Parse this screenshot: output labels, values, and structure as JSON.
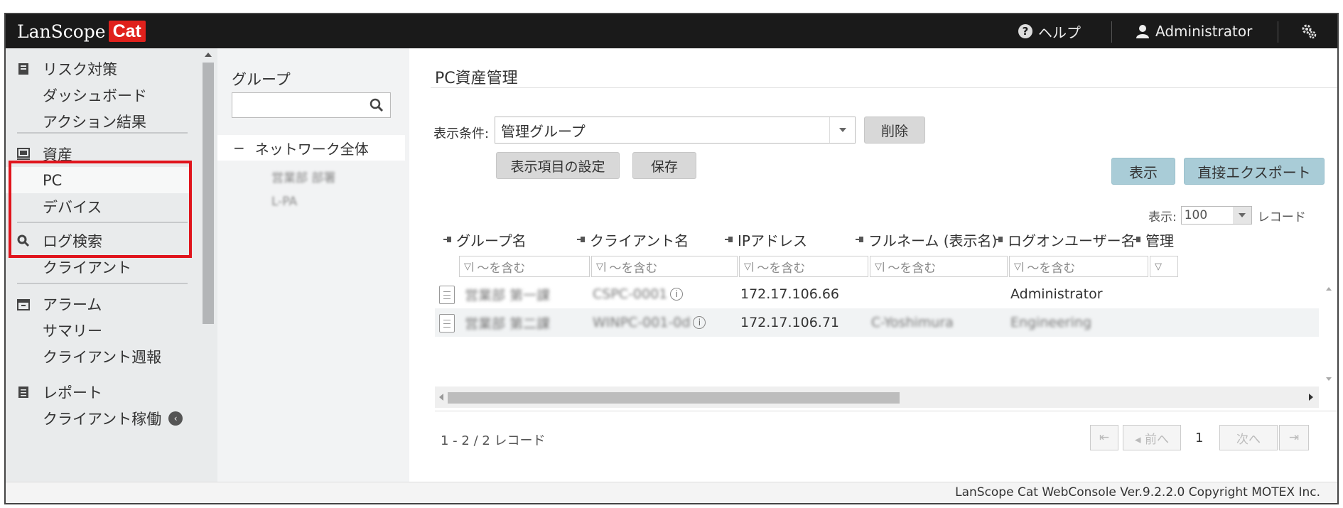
{
  "app": {
    "logo_text": "LanScope",
    "logo_badge": "Cat",
    "brand_color": "#e0211c",
    "help_label": "ヘルプ",
    "user_label": "Administrator"
  },
  "nav": {
    "risk": {
      "label": "リスク対策",
      "items": [
        "ダッシュボード",
        "アクション結果"
      ]
    },
    "asset": {
      "label": "資産",
      "items": [
        "PC",
        "デバイス"
      ]
    },
    "log": {
      "label": "ログ検索",
      "items": [
        "クライアント"
      ]
    },
    "alarm": {
      "label": "アラーム",
      "items": [
        "サマリー",
        "クライアント週報"
      ]
    },
    "report": {
      "label": "レポート",
      "items": [
        "クライアント稼働"
      ]
    },
    "highlight_color": "#e0141c"
  },
  "group_panel": {
    "title": "グループ",
    "search_placeholder": "",
    "tree_root": "ネットワーク全体",
    "tree_children": [
      "営業部 部署",
      "L-PA"
    ]
  },
  "main": {
    "title": "PC資産管理",
    "condition_label": "表示条件:",
    "condition_value": "管理グループ",
    "delete_button": "削除",
    "column_settings_button": "表示項目の設定",
    "save_button": "保存",
    "show_button": "表示",
    "export_button": "直接エクスポート",
    "page_size_label": "表示:",
    "page_size_value": "100",
    "page_size_unit": "レコード"
  },
  "grid": {
    "columns": [
      "グループ名",
      "クライアント名",
      "IPアドレス",
      "フルネーム (表示名)",
      "ログオンユーザー名",
      "管理"
    ],
    "filter_placeholder": "～を含む",
    "rows": [
      {
        "group": "営業部 第一課",
        "client": "CSPC-0001",
        "ip": "172.17.106.66",
        "fullname": "",
        "logon": "Administrator"
      },
      {
        "group": "営業部 第二課",
        "client": "WINPC-001-0d",
        "ip": "172.17.106.71",
        "fullname": "C-Yoshimura",
        "logon": "Engineering"
      }
    ]
  },
  "pager": {
    "record_count": "1 - 2 / 2 レコード",
    "first": "⇤",
    "prev": "◂ 前へ",
    "page": "1",
    "next": "次へ",
    "last": "⇥"
  },
  "footer": {
    "copyright": "LanScope Cat WebConsole Ver.9.2.2.0 Copyright MOTEX Inc."
  }
}
